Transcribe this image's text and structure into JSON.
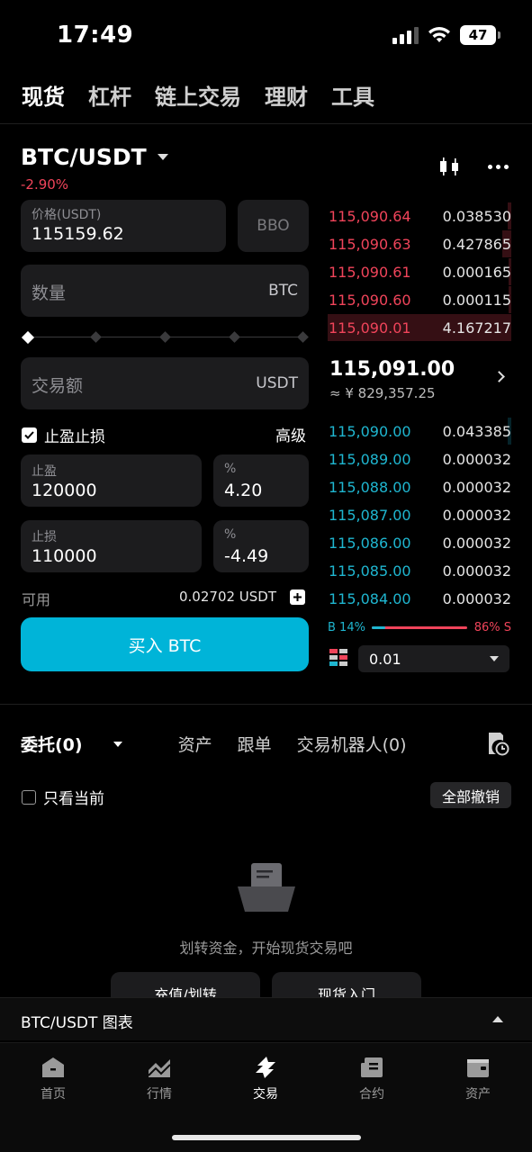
{
  "status_bar": {
    "time": "17:49",
    "battery": "47"
  },
  "top_nav": [
    "现货",
    "杠杆",
    "链上交易",
    "理财",
    "工具"
  ],
  "pair": {
    "name": "BTC/USDT",
    "change": "-2.90%"
  },
  "form": {
    "price_label": "价格(USDT)",
    "price_value": "115159.62",
    "bbo_label": "BBO",
    "qty_placeholder": "数量",
    "qty_unit": "BTC",
    "amount_placeholder": "交易额",
    "amount_unit": "USDT",
    "tpsl_label": "止盈止损",
    "advanced_label": "高级",
    "tp_label": "止盈",
    "tp_value": "120000",
    "tp_pct_label": "%",
    "tp_pct_value": "4.20",
    "sl_label": "止损",
    "sl_value": "110000",
    "sl_pct_label": "%",
    "sl_pct_value": "-4.49",
    "available_label": "可用",
    "available_value": "0.02702 USDT",
    "buy_button": "买入 BTC"
  },
  "orderbook": {
    "asks": [
      {
        "price": "115,090.64",
        "qty": "0.038530",
        "depth": 0.02
      },
      {
        "price": "115,090.63",
        "qty": "0.427865",
        "depth": 0.05
      },
      {
        "price": "115,090.61",
        "qty": "0.000165",
        "depth": 0.01
      },
      {
        "price": "115,090.60",
        "qty": "0.000115",
        "depth": 0.01
      },
      {
        "price": "115,090.01",
        "qty": "4.167217",
        "depth": 1.0
      }
    ],
    "mid_price": "115,091.00",
    "mid_sub": "≈ ¥ 829,357.25",
    "bids": [
      {
        "price": "115,090.00",
        "qty": "0.043385",
        "depth": 0.02
      },
      {
        "price": "115,089.00",
        "qty": "0.000032",
        "depth": 0.0
      },
      {
        "price": "115,088.00",
        "qty": "0.000032",
        "depth": 0.0
      },
      {
        "price": "115,087.00",
        "qty": "0.000032",
        "depth": 0.0
      },
      {
        "price": "115,086.00",
        "qty": "0.000032",
        "depth": 0.0
      },
      {
        "price": "115,085.00",
        "qty": "0.000032",
        "depth": 0.0
      },
      {
        "price": "115,084.00",
        "qty": "0.000032",
        "depth": 0.0
      }
    ],
    "buy_ratio_label": "B 14%",
    "sell_ratio_label": "86% S",
    "buy_ratio": 0.14,
    "depth_value": "0.01"
  },
  "tabs": {
    "orders": "委托(0)",
    "assets": "资产",
    "copy": "跟单",
    "bots": "交易机器人(0)"
  },
  "filter": {
    "only_current": "只看当前",
    "cancel_all": "全部撤销"
  },
  "empty_state": {
    "text": "划转资金，开始现货交易吧",
    "btn_deposit": "充值/划转",
    "btn_intro": "现货入门"
  },
  "chart_bar": {
    "label": "BTC/USDT  图表"
  },
  "bottom_nav": [
    "首页",
    "行情",
    "交易",
    "合约",
    "资产"
  ],
  "colors": {
    "ask": "#f0445a",
    "bid": "#1fb6d0",
    "buy": "#00b4d8"
  }
}
